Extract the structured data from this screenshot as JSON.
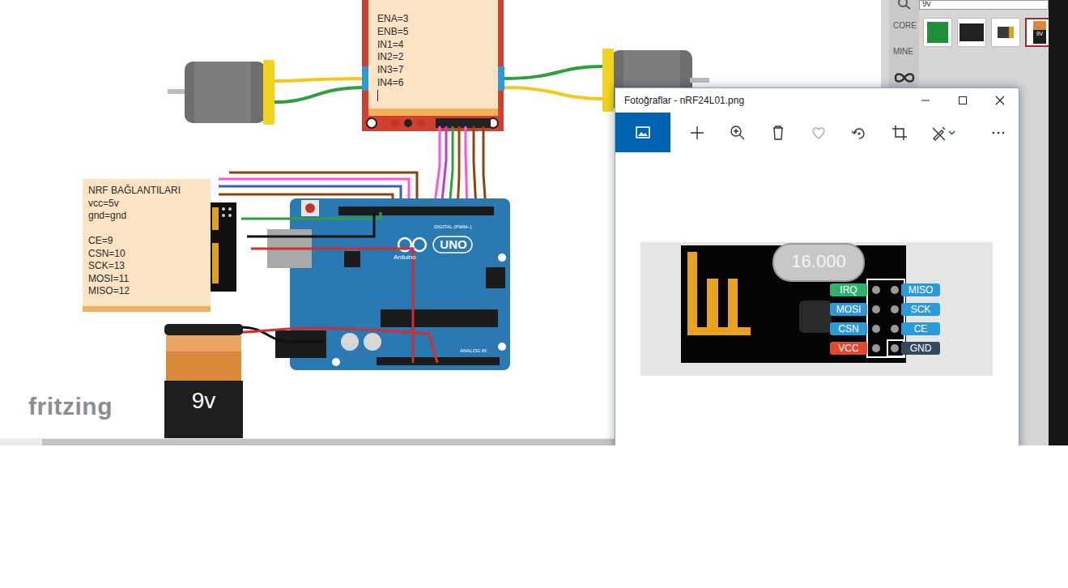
{
  "canvas": {
    "driver_note": [
      "ENA=3",
      "ENB=5",
      "IN1=4",
      "IN2=2",
      "IN3=7",
      "IN4=6"
    ],
    "nrf_note": {
      "title": "NRF BAĞLANTILARI",
      "power": [
        "vcc=5v",
        "gnd=gnd"
      ],
      "pins": [
        "CE=9",
        "CSN=10",
        "SCK=13",
        "MOSI=11",
        "MISO=12"
      ]
    },
    "arduino": {
      "model": "UNO",
      "brand": "Arduino",
      "digital": "DIGITAL (PWM~)",
      "analog": "ANALOG IN"
    },
    "battery": "9v",
    "logo": "fritzing"
  },
  "parts_bin": {
    "search": "9v",
    "tabs": [
      {
        "label": "CORE"
      },
      {
        "label": "MINE"
      }
    ],
    "part_badge": "9V"
  },
  "viewer": {
    "title": "Fotoğraflar - nRF24L01.png",
    "toolbar": [
      {
        "kind": "image",
        "selected": true
      },
      {
        "kind": "add",
        "selected": false
      },
      {
        "kind": "zoom",
        "selected": false
      },
      {
        "kind": "delete",
        "selected": false
      },
      {
        "kind": "favorite",
        "selected": false
      },
      {
        "kind": "rotate",
        "selected": false
      },
      {
        "kind": "crop",
        "selected": false
      },
      {
        "kind": "edit",
        "selected": false
      },
      {
        "kind": "more",
        "selected": false
      }
    ],
    "image": {
      "crystal": "16.000",
      "pins_left": [
        {
          "label": "IRQ",
          "color": "#2fb36a"
        },
        {
          "label": "MOSI",
          "color": "#2c9ad6"
        },
        {
          "label": "CSN",
          "color": "#2c9ad6"
        },
        {
          "label": "VCC",
          "color": "#e4472f"
        }
      ],
      "pins_right": [
        {
          "label": "MISO",
          "color": "#2c9ad6"
        },
        {
          "label": "SCK",
          "color": "#2c9ad6"
        },
        {
          "label": "CE",
          "color": "#2c9ad6"
        },
        {
          "label": "GND",
          "color": "#34495e"
        }
      ]
    }
  }
}
